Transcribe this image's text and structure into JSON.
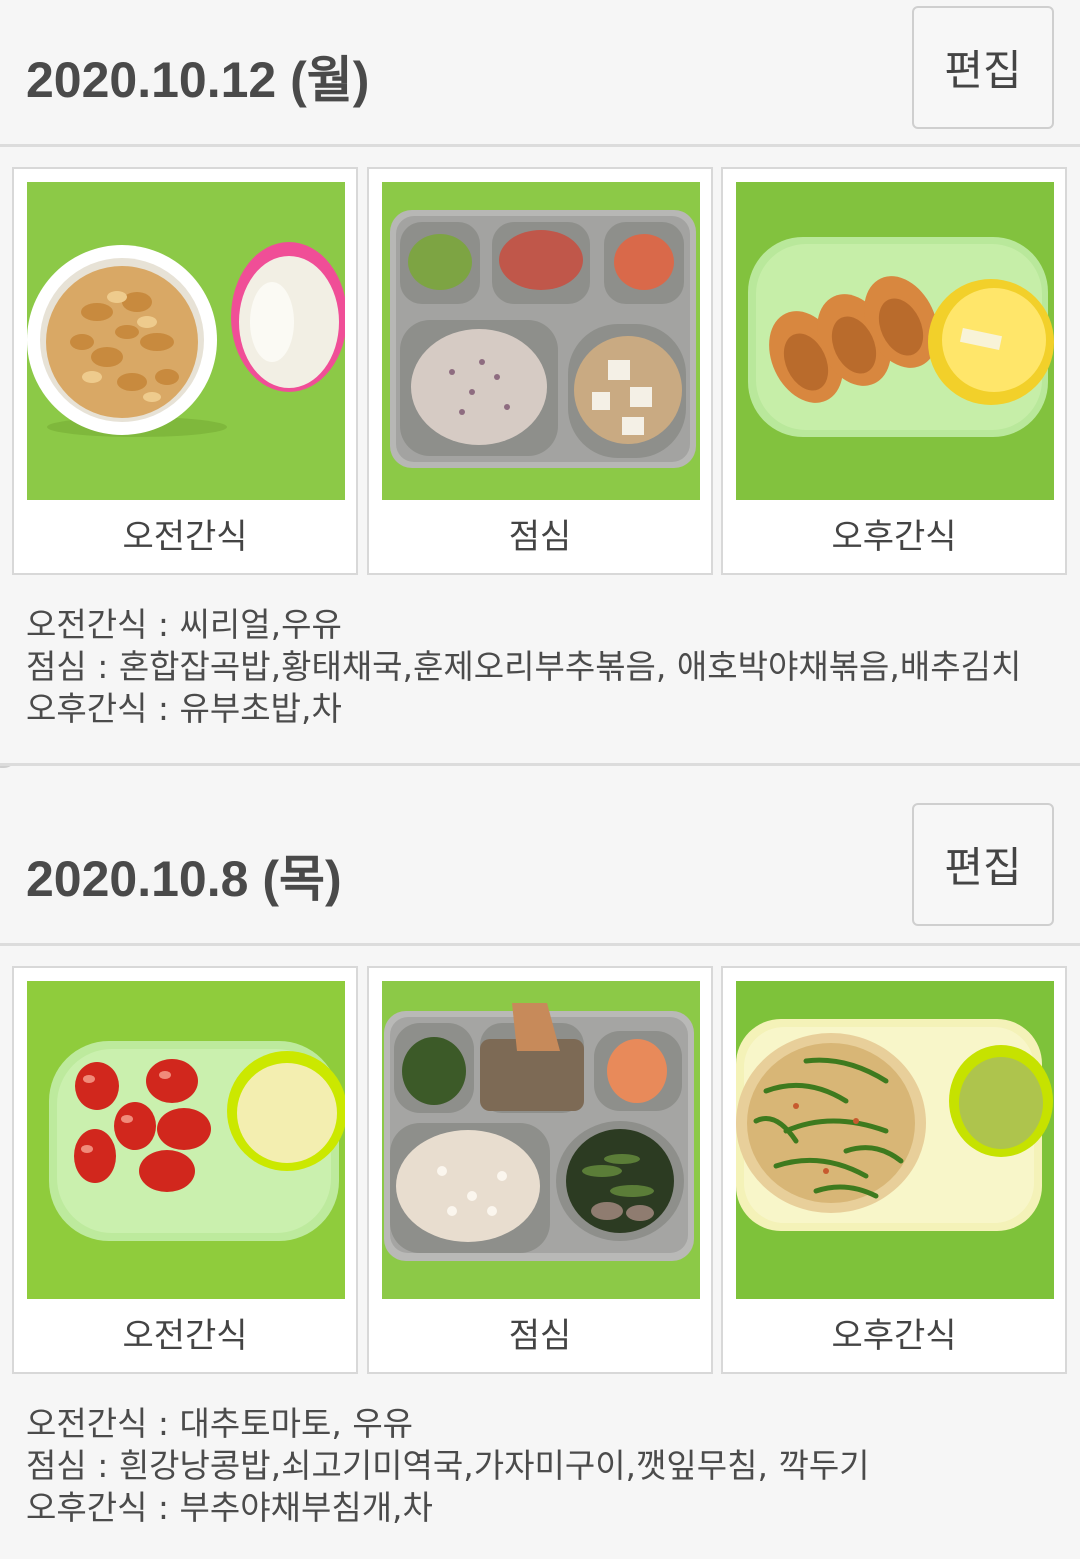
{
  "days": [
    {
      "date": "2020.10.12 (월)",
      "edit_label": "편집",
      "photos": [
        {
          "caption": "오전간식",
          "icon": "cereal-milk-photo"
        },
        {
          "caption": "점심",
          "icon": "lunch-tray-photo"
        },
        {
          "caption": "오후간식",
          "icon": "inari-sushi-photo"
        }
      ],
      "menu_lines": [
        "오전간식 : 씨리얼,우유",
        "점심 : 혼합잡곡밥,황태채국,훈제오리부추볶음, 애호박야채볶음,배추김치",
        "오후간식 : 유부초밥,차"
      ]
    },
    {
      "date": "2020.10.8 (목)",
      "edit_label": "편집",
      "photos": [
        {
          "caption": "오전간식",
          "icon": "tomato-milk-photo"
        },
        {
          "caption": "점심",
          "icon": "lunch-tray-photo"
        },
        {
          "caption": "오후간식",
          "icon": "pancake-photo"
        }
      ],
      "menu_lines": [
        "오전간식 : 대추토마토, 우유",
        "점심 : 흰강낭콩밥,쇠고기미역국,가자미구이,깻잎무침, 깍두기",
        "오후간식 : 부추야채부침개,차"
      ]
    }
  ],
  "colors": {
    "background": "#f6f6f6",
    "table_green": "#8fca45",
    "divider": "#dcdcdc"
  }
}
